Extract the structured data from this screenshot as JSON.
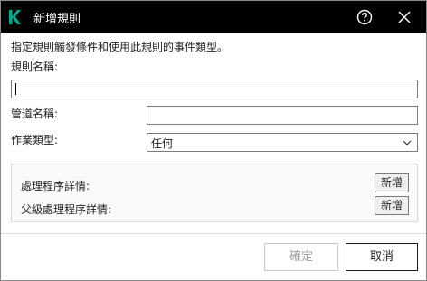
{
  "window": {
    "title": "新增規則",
    "logo_icon": "kaspersky-k-logo",
    "help_icon": "help-circle-icon",
    "close_icon": "close-x-icon",
    "accent_color": "#00a88e"
  },
  "form": {
    "instruction": "指定規則觸發條件和使用此規則的事件類型。",
    "rule_name_label": "規則名稱:",
    "rule_name_value": "",
    "pipe_name_label": "管道名稱:",
    "pipe_name_value": "",
    "operation_type_label": "作業類型:",
    "operation_type_value": "任何"
  },
  "details": {
    "process_label": "處理程序詳情:",
    "process_add_label": "新增",
    "parent_process_label": "父級處理程序詳情:",
    "parent_add_label": "新增"
  },
  "footer": {
    "ok_label": "確定",
    "cancel_label": "取消"
  }
}
